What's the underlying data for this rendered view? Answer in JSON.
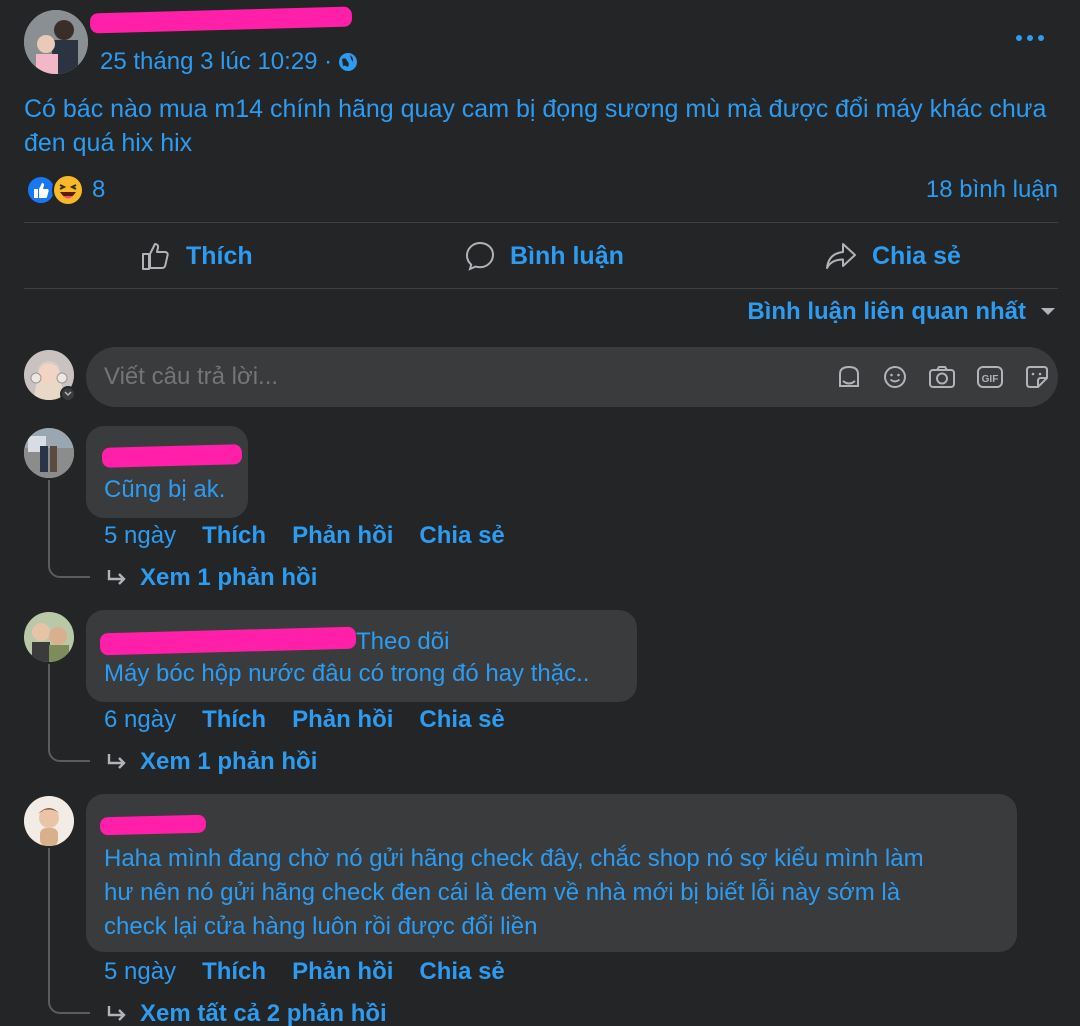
{
  "post": {
    "timestamp": "25 tháng 3 lúc 10:29 ·",
    "more_icon": "more-dots-icon",
    "text_line1": "Có bác nào mua m14 chính hãng quay cam bị đọng sương mù mà được đổi máy khác chưa",
    "text_line2": "đen quá hix hix",
    "reaction_count": "8",
    "comment_count": "18 bình luận"
  },
  "actions": {
    "like": "Thích",
    "comment": "Bình luận",
    "share": "Chia sẻ"
  },
  "sort": {
    "label": "Bình luận liên quan nhất"
  },
  "composer": {
    "placeholder": "Viết câu trả lời..."
  },
  "comments": [
    {
      "text": "Cũng bị ak.",
      "time": "5 ngày",
      "like": "Thích",
      "reply": "Phản hồi",
      "share": "Chia sẻ",
      "view_replies": "Xem 1 phản hồi"
    },
    {
      "follow": "Theo dõi",
      "text": "Máy bóc hộp nước đâu có trong đó hay thặc..",
      "time": "6 ngày",
      "like": "Thích",
      "reply": "Phản hồi",
      "share": "Chia sẻ",
      "view_replies": "Xem 1 phản hồi"
    },
    {
      "text_line1": "Haha mình đang chờ nó gửi hãng check đây, chắc shop nó sợ kiểu mình làm",
      "text_line2": "hư nên nó gửi hãng check đen cái là đem về nhà mới bị biết lỗi này sớm là",
      "text_line3": "check lại cửa hàng luôn rồi được đổi liền",
      "time": "5 ngày",
      "like": "Thích",
      "reply": "Phản hồi",
      "share": "Chia sẻ",
      "view_replies": "Xem tất cả 2 phản hồi"
    }
  ],
  "colors": {
    "background": "#242526",
    "bubble": "#3a3b3c",
    "text_accent": "#2d9bf0",
    "redaction": "#ff1fa8"
  }
}
